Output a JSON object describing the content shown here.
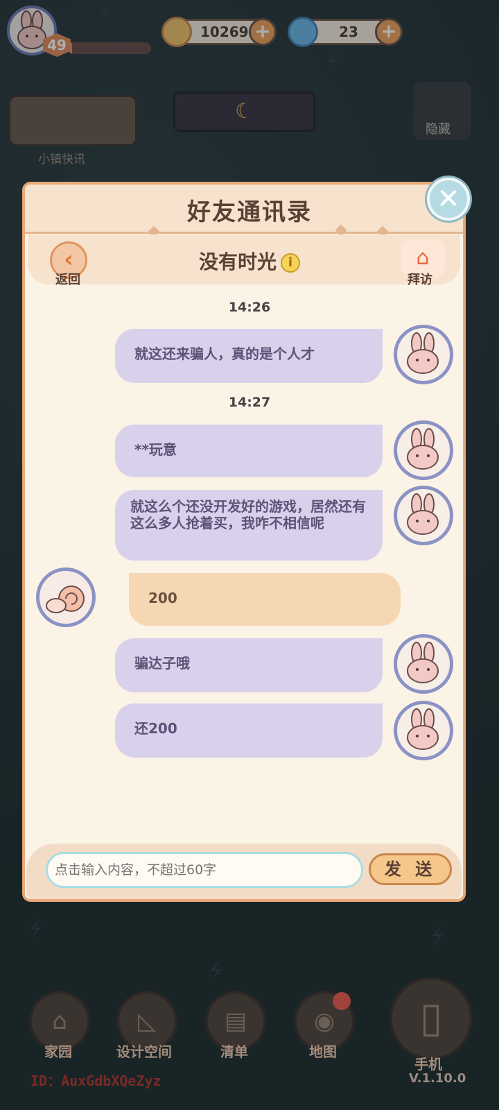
{
  "top_bar": {
    "level": "49",
    "xp_fraction": 0.05,
    "coins": "10269",
    "gems": "23"
  },
  "widgets": {
    "news_label": "小镇快讯",
    "hide_label": "隐藏"
  },
  "modal": {
    "title": "好友通讯录",
    "friend_name": "没有时光",
    "back_label": "返回",
    "visit_label": "拜访"
  },
  "chat": {
    "times": [
      "14:26",
      "14:27"
    ],
    "messages": [
      {
        "side": "right",
        "text": "就这还来骗人，真的是个人才"
      },
      {
        "side": "right",
        "text": "**玩意"
      },
      {
        "side": "right",
        "text": "就这么个还没开发好的游戏，居然还有这么多人抢着买，我咋不相信呢"
      },
      {
        "side": "left",
        "text": "200"
      },
      {
        "side": "right",
        "text": "骗达子哦"
      },
      {
        "side": "right",
        "text": "还200"
      }
    ]
  },
  "input": {
    "placeholder": "点击输入内容，不超过60字",
    "send_label": "发 送"
  },
  "nav": {
    "items": [
      {
        "label": "家园"
      },
      {
        "label": "设计空间"
      },
      {
        "label": "清单"
      },
      {
        "label": "地图"
      },
      {
        "label": "手机"
      }
    ]
  },
  "footer": {
    "user_id": "ID：AuxGdbXQeZyz",
    "version": "V.1.10.0"
  },
  "colors": {
    "modal_bg": "#fcf3e7",
    "my_bubble": "#d9d1ec",
    "their_bubble": "#f6d7b3",
    "accent": "#e8a878"
  }
}
